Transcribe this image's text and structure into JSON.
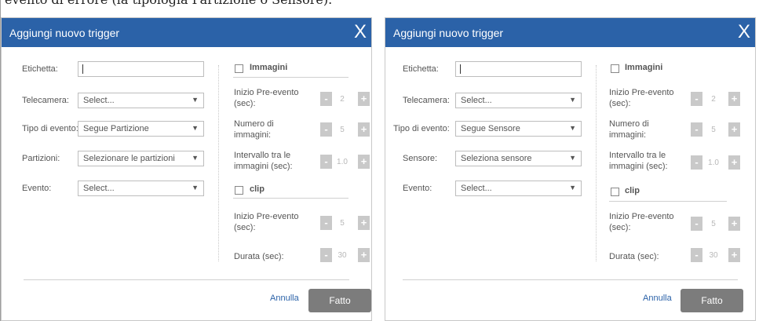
{
  "page": {
    "caption": "evento di errore (la tipologia Partizione o Sensore)."
  },
  "dialogs": [
    {
      "title": "Aggiungi nuovo trigger",
      "close": "X",
      "fields": {
        "etichetta_label": "Etichetta:",
        "telecamera_label": "Telecamera:",
        "telecamera_value": "Select...",
        "tipo_label": "Tipo di evento:",
        "tipo_value": "Segue Partizione",
        "fourth_label": "Partizioni:",
        "fourth_value": "Selezionare le partizioni",
        "evento_label": "Evento:",
        "evento_value": "Select..."
      },
      "immagini": {
        "label": "Immagini",
        "pre_label_1": "Inizio Pre-evento",
        "pre_label_2": "(sec):",
        "pre_value": "2",
        "num_label_1": "Numero di",
        "num_label_2": "immagini:",
        "num_value": "5",
        "int_label_1": "Intervallo tra le",
        "int_label_2": "immagini (sec):",
        "int_value": "1.0"
      },
      "clip": {
        "label": "clip",
        "pre_label_1": "Inizio Pre-evento",
        "pre_label_2": "(sec):",
        "pre_value": "5",
        "dur_label": "Durata (sec):",
        "dur_value": "30"
      },
      "minus": "-",
      "plus": "+",
      "cancel": "Annulla",
      "done": "Fatto"
    },
    {
      "title": "Aggiungi nuovo trigger",
      "close": "X",
      "fields": {
        "etichetta_label": "Etichetta:",
        "telecamera_label": "Telecamera:",
        "telecamera_value": "Select...",
        "tipo_label": "Tipo di evento:",
        "tipo_value": "Segue Sensore",
        "fourth_label": "Sensore:",
        "fourth_value": "Seleziona sensore",
        "evento_label": "Evento:",
        "evento_value": "Select..."
      },
      "immagini": {
        "label": "Immagini",
        "pre_label_1": "Inizio Pre-evento",
        "pre_label_2": "(sec):",
        "pre_value": "2",
        "num_label_1": "Numero di",
        "num_label_2": "immagini:",
        "num_value": "5",
        "int_label_1": "Intervallo tra le",
        "int_label_2": "immagini (sec):",
        "int_value": "1.0"
      },
      "clip": {
        "label": "clip",
        "pre_label_1": "Inizio Pre-evento",
        "pre_label_2": "(sec):",
        "pre_value": "5",
        "dur_label": "Durata (sec):",
        "dur_value": "30"
      },
      "minus": "-",
      "plus": "+",
      "cancel": "Annulla",
      "done": "Fatto"
    }
  ]
}
